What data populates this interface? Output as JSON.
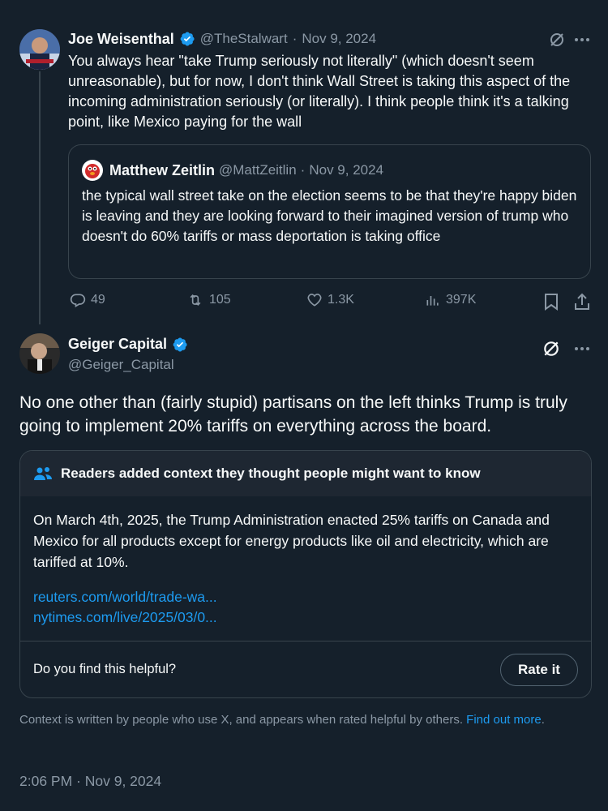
{
  "colors": {
    "background": "#15202b",
    "accent": "#1d9bf0",
    "muted": "#8b98a5",
    "border": "#38444d"
  },
  "tweet1": {
    "author_name": "Joe Weisenthal",
    "handle": "@TheStalwart",
    "separator": "·",
    "date": "Nov 9, 2024",
    "text": "You always hear \"take Trump seriously not literally\" (which doesn't seem unreasonable), but for now, I don't think Wall Street is taking this aspect of the incoming administration seriously (or literally). I think people think it's a talking point, like Mexico paying for the wall",
    "quote": {
      "author_name": "Matthew Zeitlin",
      "handle": "@MattZeitlin",
      "separator": "·",
      "date": "Nov 9, 2024",
      "text": "the typical wall street take on the election seems to be that they're happy biden is leaving and they are looking forward to their imagined version of trump who doesn't do 60% tariffs or mass deportation is taking office"
    },
    "stats": {
      "replies": "49",
      "reposts": "105",
      "likes": "1.3K",
      "views": "397K"
    }
  },
  "tweet2": {
    "author_name": "Geiger Capital",
    "handle": "@Geiger_Capital",
    "text": "No one other than (fairly stupid) partisans on the left thinks Trump is truly going to implement 20% tariffs on everything across the board.",
    "note": {
      "header": "Readers added context they thought people might want to know",
      "body": "On March 4th, 2025, the Trump Administration enacted 25% tariffs on Canada and Mexico for all products except for energy products like oil and electricity, which are tariffed at 10%.",
      "links": [
        "reuters.com/world/trade-wa...",
        "nytimes.com/live/2025/03/0..."
      ],
      "helpful_question": "Do you find this helpful?",
      "rate_label": "Rate it"
    },
    "footer_text": "Context is written by people who use X, and appears when rated helpful by others.",
    "find_out_more": "Find out more",
    "period": ".",
    "timestamp": "2:06 PM · Nov 9, 2024"
  }
}
